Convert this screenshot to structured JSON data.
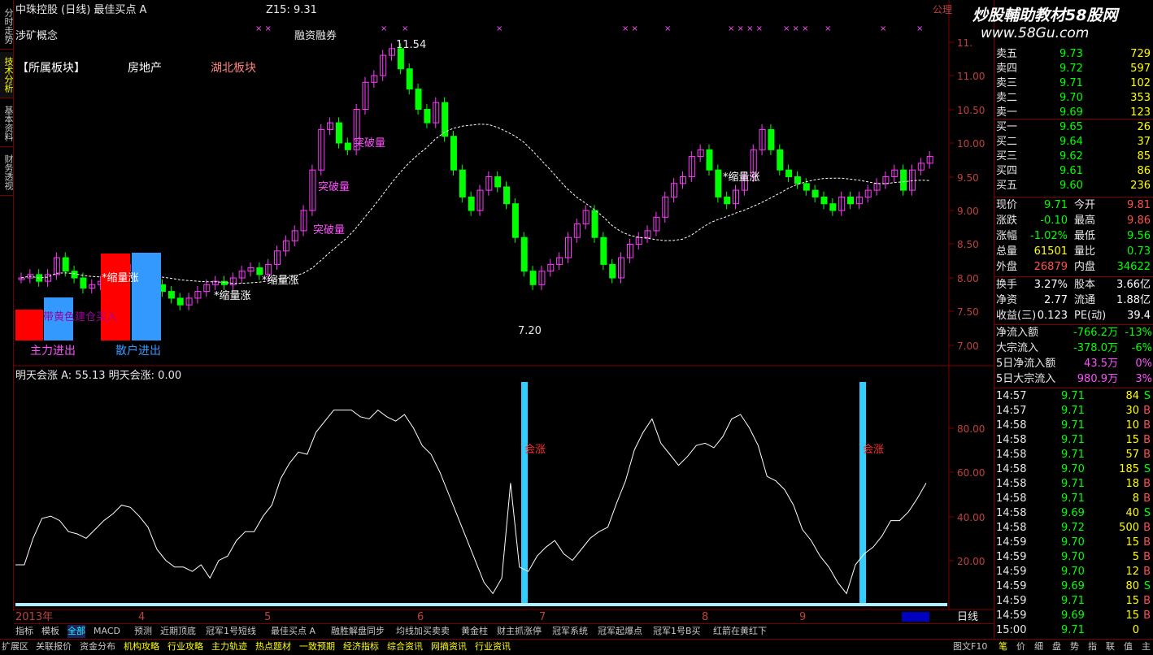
{
  "left_tabs": [
    {
      "label": "分时走势",
      "active": false
    },
    {
      "label": "技术分析",
      "active": true
    },
    {
      "label": "基本资料",
      "active": false
    },
    {
      "label": "财务透视",
      "active": false
    }
  ],
  "header": {
    "title": "中珠控股 (日线) 最佳买点 A",
    "z15_label": "Z15: 9.31",
    "concept": "涉矿概念",
    "margin": "融资融券",
    "watermark": "炒股輔助教材58股网",
    "watermark_url": "www.58Gu.com",
    "corner_label": "公理"
  },
  "sector": {
    "prefix": "【所属板块】",
    "items": [
      "房地产",
      "湖北板块"
    ]
  },
  "annotations": {
    "high": "11.54",
    "low": "7.20",
    "breakouts": [
      "突破量",
      "突破量",
      "突破量"
    ],
    "shrinks": [
      "*缩量涨",
      "*缩量涨",
      "*缩量涨",
      "*缩量涨"
    ],
    "overlay_text": "带黄色建仓买入",
    "main_force": "主力进出",
    "retail": "散户进出"
  },
  "price_axis": {
    "ticks": [
      "11.",
      "11.00",
      "10.50",
      "10.00",
      "9.50",
      "9.00",
      "8.50",
      "8.00",
      "7.50",
      "7.00"
    ]
  },
  "sub_chart": {
    "label": "明天会涨 A: 55.13  明天会涨: 0.00",
    "ticks": [
      "80.00",
      "60.00",
      "40.00",
      "20.00"
    ],
    "spike_label": "会涨"
  },
  "time_axis": {
    "labels": [
      "2013年",
      "4",
      "5",
      "6",
      "7",
      "8",
      "9"
    ],
    "period": "日线",
    "controls": [
      "—",
      "+",
      "0"
    ]
  },
  "chart_data": {
    "type": "line",
    "series": [
      {
        "values": [
          18,
          18,
          30,
          39,
          40,
          38,
          33,
          32,
          30,
          34,
          38,
          41,
          45,
          44,
          40,
          35,
          25,
          20,
          17,
          17,
          15,
          18,
          12,
          20,
          22,
          29,
          33,
          33,
          40,
          45,
          57,
          64,
          69,
          68,
          78,
          83,
          88,
          88,
          88,
          85,
          84,
          88,
          85,
          83,
          86,
          80,
          72,
          68,
          60,
          50,
          40,
          30,
          20,
          10,
          5,
          12,
          55,
          17,
          15,
          22,
          26,
          29,
          23,
          20,
          25,
          30,
          33,
          35,
          46,
          56,
          70,
          78,
          84,
          73,
          68,
          63,
          67,
          72,
          73,
          71,
          76,
          84,
          86,
          80,
          72,
          58,
          56,
          52,
          45,
          34,
          29,
          22,
          17,
          10,
          5,
          18,
          23,
          26,
          31,
          38,
          38,
          42,
          48,
          55
        ]
      }
    ]
  },
  "orderbook": {
    "asks": [
      {
        "label": "卖五",
        "price": "9.73",
        "vol": "729"
      },
      {
        "label": "卖四",
        "price": "9.72",
        "vol": "597"
      },
      {
        "label": "卖三",
        "price": "9.71",
        "vol": "102"
      },
      {
        "label": "卖二",
        "price": "9.70",
        "vol": "353"
      },
      {
        "label": "卖一",
        "price": "9.69",
        "vol": "123"
      }
    ],
    "bids": [
      {
        "label": "买一",
        "price": "9.65",
        "vol": "26"
      },
      {
        "label": "买二",
        "price": "9.64",
        "vol": "37"
      },
      {
        "label": "买三",
        "price": "9.62",
        "vol": "85"
      },
      {
        "label": "买四",
        "price": "9.61",
        "vol": "86"
      },
      {
        "label": "买五",
        "price": "9.60",
        "vol": "236"
      }
    ]
  },
  "quote": [
    {
      "l1": "现价",
      "v1": "9.71",
      "c1": "#00ff00",
      "l2": "今开",
      "v2": "9.81",
      "c2": "#ff5050"
    },
    {
      "l1": "涨跌",
      "v1": "-0.10",
      "c1": "#00ff00",
      "l2": "最高",
      "v2": "9.86",
      "c2": "#ff5050"
    },
    {
      "l1": "涨幅",
      "v1": "-1.02%",
      "c1": "#00ff00",
      "l2": "最低",
      "v2": "9.56",
      "c2": "#00ff00"
    },
    {
      "l1": "总量",
      "v1": "61501",
      "c1": "#ffff00",
      "l2": "量比",
      "v2": "0.73",
      "c2": "#00ff00"
    },
    {
      "l1": "外盘",
      "v1": "26879",
      "c1": "#ff5050",
      "l2": "内盘",
      "v2": "34622",
      "c2": "#00ff00"
    }
  ],
  "fundamentals": [
    {
      "l1": "换手",
      "v1": "3.27%",
      "l2": "股本",
      "v2": "3.66亿"
    },
    {
      "l1": "净资",
      "v1": "2.77",
      "l2": "流通",
      "v2": "1.88亿"
    },
    {
      "l1": "收益(三)",
      "v1": "0.123",
      "l2": "PE(动)",
      "v2": "39.4"
    }
  ],
  "flows": [
    {
      "label": "净流入额",
      "value": "-766.2万",
      "pct": "-13%",
      "color": "#00ff00"
    },
    {
      "label": "大宗流入",
      "value": "-378.0万",
      "pct": "-6%",
      "color": "#00ff00"
    },
    {
      "label": "5日净流入额",
      "value": "43.5万",
      "pct": "0%",
      "color": "#ff50ff"
    },
    {
      "label": "5日大宗流入",
      "value": "980.9万",
      "pct": "3%",
      "color": "#ff50ff"
    }
  ],
  "ticks": [
    {
      "time": "14:57",
      "price": "9.71",
      "vol": "84",
      "bs": "S"
    },
    {
      "time": "14:57",
      "price": "9.71",
      "vol": "30",
      "bs": "B"
    },
    {
      "time": "14:58",
      "price": "9.71",
      "vol": "10",
      "bs": "B"
    },
    {
      "time": "14:58",
      "price": "9.71",
      "vol": "15",
      "bs": "B"
    },
    {
      "time": "14:58",
      "price": "9.71",
      "vol": "57",
      "bs": "B"
    },
    {
      "time": "14:58",
      "price": "9.70",
      "vol": "185",
      "bs": "S"
    },
    {
      "time": "14:58",
      "price": "9.71",
      "vol": "18",
      "bs": "B"
    },
    {
      "time": "14:58",
      "price": "9.71",
      "vol": "8",
      "bs": "B"
    },
    {
      "time": "14:58",
      "price": "9.69",
      "vol": "40",
      "bs": "S"
    },
    {
      "time": "14:58",
      "price": "9.72",
      "vol": "500",
      "bs": "B"
    },
    {
      "time": "14:59",
      "price": "9.70",
      "vol": "15",
      "bs": "B"
    },
    {
      "time": "14:59",
      "price": "9.70",
      "vol": "5",
      "bs": "B"
    },
    {
      "time": "14:59",
      "price": "9.70",
      "vol": "12",
      "bs": "B"
    },
    {
      "time": "14:59",
      "price": "9.69",
      "vol": "80",
      "bs": "S"
    },
    {
      "time": "14:59",
      "price": "9.71",
      "vol": "15",
      "bs": "B"
    },
    {
      "time": "14:59",
      "price": "9.69",
      "vol": "15",
      "bs": "B"
    },
    {
      "time": "15:00",
      "price": "9.71",
      "vol": "0",
      "bs": ""
    }
  ],
  "bottom_tabs": [
    "指标",
    "模板",
    "全部",
    "MACD",
    "预测",
    "近期顶底",
    "冠军1号短线",
    "最佳买点 A",
    "融胜解盘同步",
    "均线加买卖卖",
    "黄金柱",
    "财主抓涨停",
    "冠军系统",
    "冠军起爆点",
    "冠军1号B买",
    "红箭在黄红下"
  ],
  "bottom_bar": [
    "扩展区",
    "关联报价",
    "资金分布",
    "机构攻略",
    "行业攻略",
    "主力轨迹",
    "热点题材",
    "一致预期",
    "经济指标",
    "综合资讯",
    "网摘资讯",
    "行业资讯"
  ],
  "bottom_bar_right": "图文F10",
  "right_bottom_tabs": [
    "笔",
    "价",
    "细",
    "盘",
    "势",
    "指",
    "联",
    "值",
    "主"
  ],
  "colors": {
    "up": "#ff3bff",
    "down": "#00ff00",
    "grid": "#800000",
    "accent": "#ffff00"
  }
}
